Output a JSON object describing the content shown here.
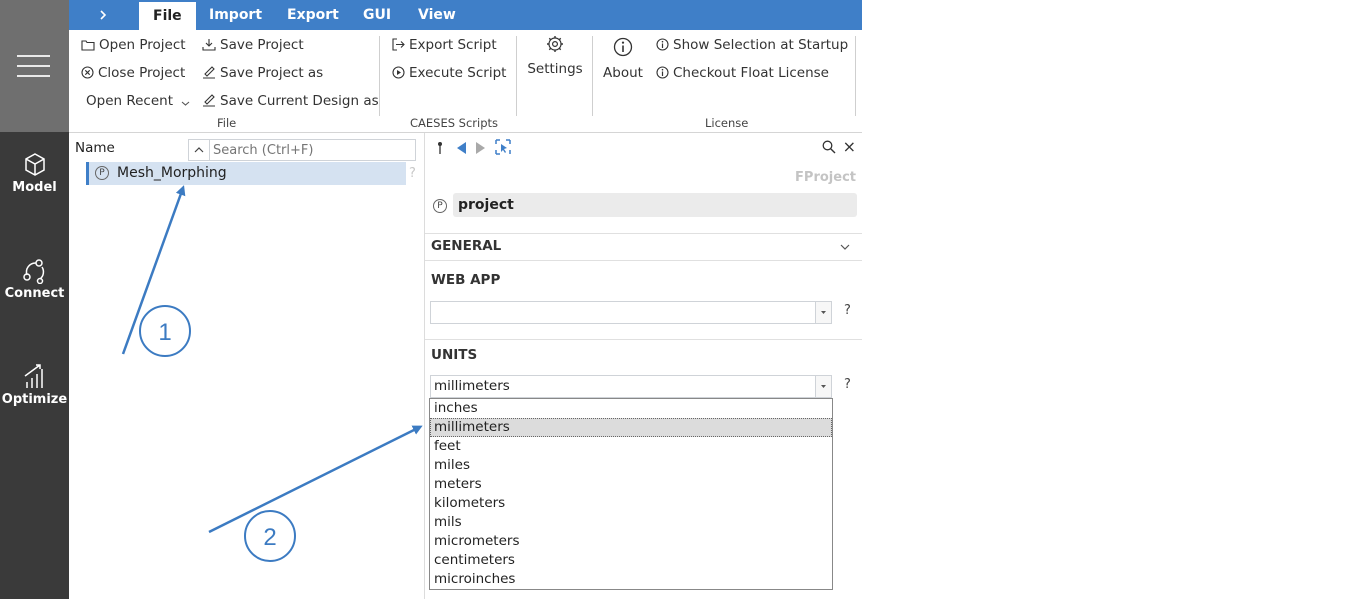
{
  "tabs": [
    "File",
    "Import",
    "Export",
    "GUI",
    "View"
  ],
  "tabs_expand_icon": "chevron-right-icon",
  "ribbon": {
    "file_group": {
      "open_project": "Open Project",
      "close_project": "Close Project",
      "open_recent": "Open Recent",
      "save_project": "Save Project",
      "save_project_as": "Save Project as",
      "save_current_design_as": "Save Current Design as",
      "label": "File"
    },
    "scripts_group": {
      "export_script": "Export Script",
      "execute_script": "Execute Script",
      "label": "CAESES Scripts"
    },
    "settings": "Settings",
    "about": "About",
    "license_group": {
      "show_selection": "Show Selection at Startup",
      "checkout_license": "Checkout Float License",
      "label": "License"
    }
  },
  "nav": [
    {
      "label": "Model",
      "icon": "cube-icon"
    },
    {
      "label": "Connect",
      "icon": "connect-icon"
    },
    {
      "label": "Optimize",
      "icon": "optimize-icon"
    }
  ],
  "tree": {
    "name_label": "Name",
    "search_placeholder": "Search (Ctrl+F)",
    "item": "Mesh_Morphing",
    "item_badge": "P",
    "help": "?"
  },
  "props": {
    "class_name": "FProject",
    "object_name": "project",
    "object_badge": "P",
    "sections": {
      "general": "GENERAL",
      "web_app": "WEB APP",
      "units": "UNITS"
    },
    "web_app_value": "",
    "units_value": "millimeters",
    "help": "?",
    "close": "×"
  },
  "units_options": [
    "inches",
    "millimeters",
    "feet",
    "miles",
    "meters",
    "kilometers",
    "mils",
    "micrometers",
    "centimeters",
    "microinches"
  ],
  "selected_unit_index": 1,
  "annotations": [
    "1",
    "2"
  ],
  "colors": {
    "accent": "#3f7fc8",
    "sidebar": "#3a3a3a",
    "sidebar_top": "#6f6f6f",
    "annotation": "#3c7bc2"
  }
}
